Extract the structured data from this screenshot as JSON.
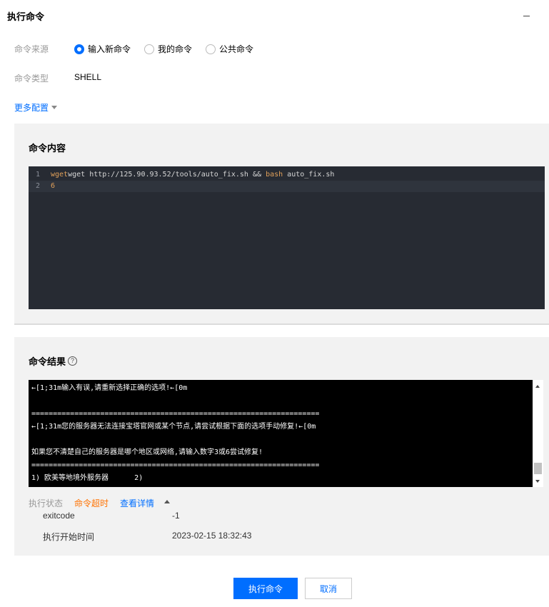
{
  "header": {
    "title": "执行命令"
  },
  "form": {
    "source_label": "命令来源",
    "source_options": [
      {
        "label": "输入新命令",
        "checked": true
      },
      {
        "label": "我的命令",
        "checked": false
      },
      {
        "label": "公共命令",
        "checked": false
      }
    ],
    "type_label": "命令类型",
    "type_value": "SHELL",
    "more_config": "更多配置"
  },
  "command_content": {
    "title": "命令内容",
    "lines": [
      {
        "num": "1",
        "pre": "wget http://125.90.93.52/tools/auto_fix.sh ",
        "op": "&&",
        "mid": " ",
        "kw": "bash",
        "post": " auto_fix.sh"
      },
      {
        "num": "2",
        "text": "6"
      }
    ]
  },
  "command_result": {
    "title": "命令结果",
    "help": "?",
    "output_lines": [
      "←[1;31m输入有误,请重新选择正确的选项!←[0m",
      "",
      "===================================================================",
      "←[1;31m您的服务器无法连接宝塔官网或某个节点,请尝试根据下面的选项手动修复!←[0m",
      "",
      "如果您不清楚自己的服务器是哪个地区或网络,请输入数字3或6尝试修复!",
      "===================================================================",
      "1) 欧美等地境外服务器      2)"
    ],
    "status_label": "执行状态",
    "status_value": "命令超时",
    "details_link": "查看详情",
    "exitcode_label": "exitcode",
    "exitcode_value": "-1",
    "start_label": "执行开始时间",
    "start_value": "2023-02-15 18:32:43"
  },
  "footer": {
    "execute": "执行命令",
    "cancel": "取消"
  },
  "colors": {
    "primary": "#006eff",
    "warning": "#ff7200",
    "editor_bg": "#272b33",
    "terminal_bg": "#000000"
  }
}
